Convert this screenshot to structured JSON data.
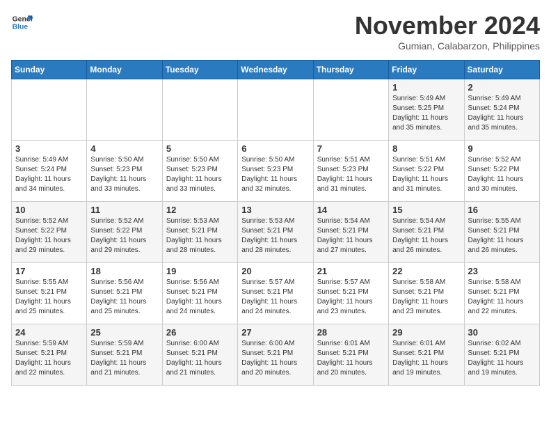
{
  "header": {
    "logo_line1": "General",
    "logo_line2": "Blue",
    "month": "November 2024",
    "location": "Gumian, Calabarzon, Philippines"
  },
  "weekdays": [
    "Sunday",
    "Monday",
    "Tuesday",
    "Wednesday",
    "Thursday",
    "Friday",
    "Saturday"
  ],
  "weeks": [
    [
      {
        "day": "",
        "info": ""
      },
      {
        "day": "",
        "info": ""
      },
      {
        "day": "",
        "info": ""
      },
      {
        "day": "",
        "info": ""
      },
      {
        "day": "",
        "info": ""
      },
      {
        "day": "1",
        "info": "Sunrise: 5:49 AM\nSunset: 5:25 PM\nDaylight: 11 hours\nand 35 minutes."
      },
      {
        "day": "2",
        "info": "Sunrise: 5:49 AM\nSunset: 5:24 PM\nDaylight: 11 hours\nand 35 minutes."
      }
    ],
    [
      {
        "day": "3",
        "info": "Sunrise: 5:49 AM\nSunset: 5:24 PM\nDaylight: 11 hours\nand 34 minutes."
      },
      {
        "day": "4",
        "info": "Sunrise: 5:50 AM\nSunset: 5:23 PM\nDaylight: 11 hours\nand 33 minutes."
      },
      {
        "day": "5",
        "info": "Sunrise: 5:50 AM\nSunset: 5:23 PM\nDaylight: 11 hours\nand 33 minutes."
      },
      {
        "day": "6",
        "info": "Sunrise: 5:50 AM\nSunset: 5:23 PM\nDaylight: 11 hours\nand 32 minutes."
      },
      {
        "day": "7",
        "info": "Sunrise: 5:51 AM\nSunset: 5:23 PM\nDaylight: 11 hours\nand 31 minutes."
      },
      {
        "day": "8",
        "info": "Sunrise: 5:51 AM\nSunset: 5:22 PM\nDaylight: 11 hours\nand 31 minutes."
      },
      {
        "day": "9",
        "info": "Sunrise: 5:52 AM\nSunset: 5:22 PM\nDaylight: 11 hours\nand 30 minutes."
      }
    ],
    [
      {
        "day": "10",
        "info": "Sunrise: 5:52 AM\nSunset: 5:22 PM\nDaylight: 11 hours\nand 29 minutes."
      },
      {
        "day": "11",
        "info": "Sunrise: 5:52 AM\nSunset: 5:22 PM\nDaylight: 11 hours\nand 29 minutes."
      },
      {
        "day": "12",
        "info": "Sunrise: 5:53 AM\nSunset: 5:21 PM\nDaylight: 11 hours\nand 28 minutes."
      },
      {
        "day": "13",
        "info": "Sunrise: 5:53 AM\nSunset: 5:21 PM\nDaylight: 11 hours\nand 28 minutes."
      },
      {
        "day": "14",
        "info": "Sunrise: 5:54 AM\nSunset: 5:21 PM\nDaylight: 11 hours\nand 27 minutes."
      },
      {
        "day": "15",
        "info": "Sunrise: 5:54 AM\nSunset: 5:21 PM\nDaylight: 11 hours\nand 26 minutes."
      },
      {
        "day": "16",
        "info": "Sunrise: 5:55 AM\nSunset: 5:21 PM\nDaylight: 11 hours\nand 26 minutes."
      }
    ],
    [
      {
        "day": "17",
        "info": "Sunrise: 5:55 AM\nSunset: 5:21 PM\nDaylight: 11 hours\nand 25 minutes."
      },
      {
        "day": "18",
        "info": "Sunrise: 5:56 AM\nSunset: 5:21 PM\nDaylight: 11 hours\nand 25 minutes."
      },
      {
        "day": "19",
        "info": "Sunrise: 5:56 AM\nSunset: 5:21 PM\nDaylight: 11 hours\nand 24 minutes."
      },
      {
        "day": "20",
        "info": "Sunrise: 5:57 AM\nSunset: 5:21 PM\nDaylight: 11 hours\nand 24 minutes."
      },
      {
        "day": "21",
        "info": "Sunrise: 5:57 AM\nSunset: 5:21 PM\nDaylight: 11 hours\nand 23 minutes."
      },
      {
        "day": "22",
        "info": "Sunrise: 5:58 AM\nSunset: 5:21 PM\nDaylight: 11 hours\nand 23 minutes."
      },
      {
        "day": "23",
        "info": "Sunrise: 5:58 AM\nSunset: 5:21 PM\nDaylight: 11 hours\nand 22 minutes."
      }
    ],
    [
      {
        "day": "24",
        "info": "Sunrise: 5:59 AM\nSunset: 5:21 PM\nDaylight: 11 hours\nand 22 minutes."
      },
      {
        "day": "25",
        "info": "Sunrise: 5:59 AM\nSunset: 5:21 PM\nDaylight: 11 hours\nand 21 minutes."
      },
      {
        "day": "26",
        "info": "Sunrise: 6:00 AM\nSunset: 5:21 PM\nDaylight: 11 hours\nand 21 minutes."
      },
      {
        "day": "27",
        "info": "Sunrise: 6:00 AM\nSunset: 5:21 PM\nDaylight: 11 hours\nand 20 minutes."
      },
      {
        "day": "28",
        "info": "Sunrise: 6:01 AM\nSunset: 5:21 PM\nDaylight: 11 hours\nand 20 minutes."
      },
      {
        "day": "29",
        "info": "Sunrise: 6:01 AM\nSunset: 5:21 PM\nDaylight: 11 hours\nand 19 minutes."
      },
      {
        "day": "30",
        "info": "Sunrise: 6:02 AM\nSunset: 5:21 PM\nDaylight: 11 hours\nand 19 minutes."
      }
    ]
  ]
}
